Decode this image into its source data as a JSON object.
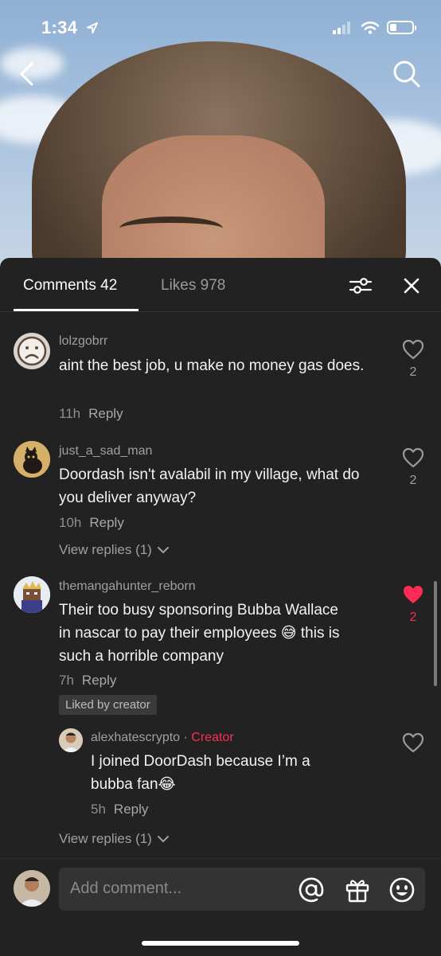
{
  "status_bar": {
    "time": "1:34"
  },
  "tabs": {
    "comments": "Comments 42",
    "likes": "Likes 978"
  },
  "comments": [
    {
      "username": "lolzgobrr",
      "text": "aint the best job, u make no money gas does.",
      "time": "11h",
      "reply": "Reply",
      "likes": "2",
      "liked": false
    },
    {
      "username": "just_a_sad_man",
      "text": "Doordash isn't avalabil in my village, what do you deliver anyway?",
      "time": "10h",
      "reply": "Reply",
      "likes": "2",
      "liked": false,
      "view_replies": "View replies (1)"
    },
    {
      "username": "themangahunter_reborn",
      "text_line1": "Their too busy sponsoring Bubba Wallace",
      "text_line2": "in nascar to pay their employees 😅 this is",
      "text_line3": "such a horrible company",
      "time": "7h",
      "reply": "Reply",
      "likes": "2",
      "liked": true,
      "badge": "Liked by creator",
      "view_replies": "View replies (1)",
      "reply_item": {
        "username": "alexhatescrypto",
        "separator": "·",
        "creator_label": "Creator",
        "text": "I joined DoorDash because I’m a bubba fan😂",
        "time": "5h",
        "reply": "Reply"
      }
    }
  ],
  "input": {
    "placeholder": "Add comment..."
  },
  "colors": {
    "accent": "#fe2c55",
    "sheet": "#222222"
  },
  "icons": [
    "back-icon",
    "search-icon",
    "filter-icon",
    "close-icon",
    "heart-icon",
    "at-icon",
    "gift-icon",
    "emoji-icon"
  ]
}
